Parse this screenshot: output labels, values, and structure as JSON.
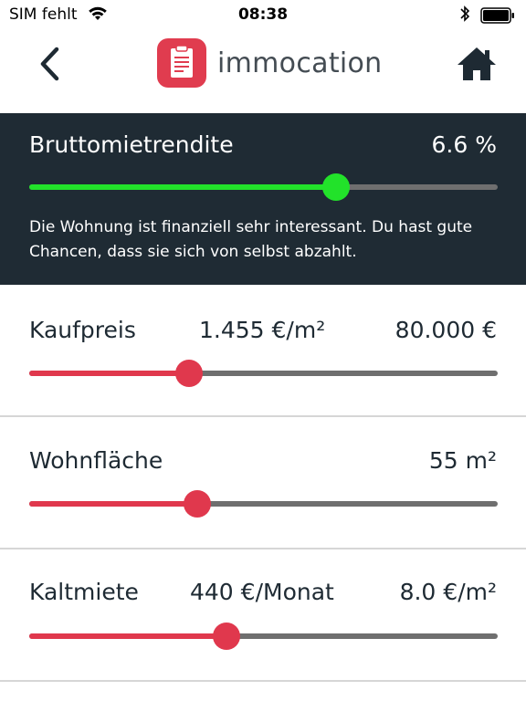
{
  "status_bar": {
    "carrier": "SIM fehlt",
    "time": "08:38"
  },
  "header": {
    "app_name": "immocation",
    "brand_color": "#e03c4f"
  },
  "yield": {
    "label": "Bruttomietrendite",
    "value": "6.6 %",
    "level": 0.655,
    "fill_color": "#22e22a",
    "description": "Die Wohnung ist finanziell sehr interessant. Du hast gute Chancen, dass sie sich von selbst abzahlt."
  },
  "rows": {
    "purchase": {
      "label": "Kaufpreis",
      "per_sqm": "1.455 €/m²",
      "total": "80.000 €",
      "level": 0.342
    },
    "area": {
      "label": "Wohnfläche",
      "value": "55 m²",
      "level": 0.358
    },
    "rent": {
      "label": "Kaltmiete",
      "monthly": "440 €/Monat",
      "per_sqm": "8.0 €/m²",
      "level": 0.421
    }
  },
  "colors": {
    "slider_fill": "#e0384d",
    "track": "#6f6f6f",
    "panel_bg": "#1f2b34"
  }
}
